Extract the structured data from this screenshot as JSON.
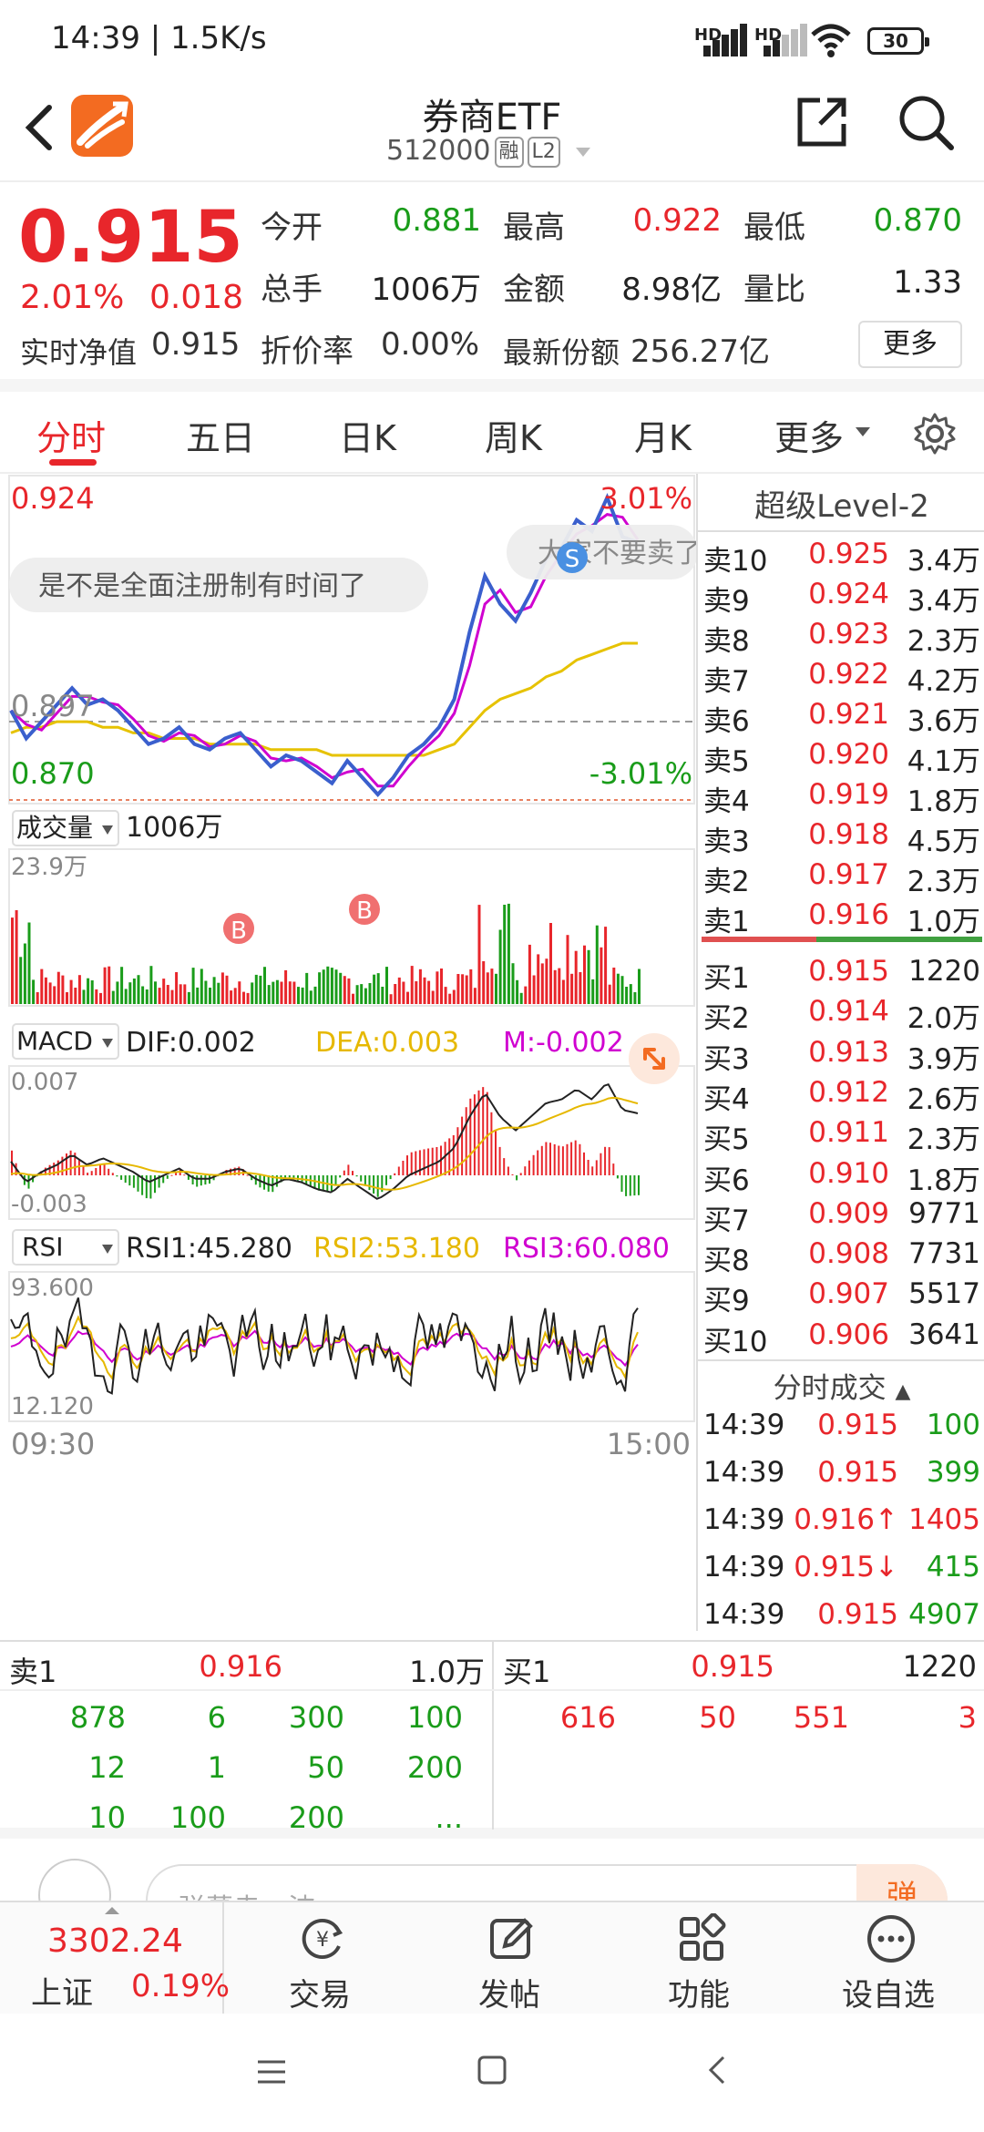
{
  "status": {
    "time": "14:39 | 1.5K/s",
    "sim1": "HD",
    "sim2": "HD",
    "battery": "30"
  },
  "header": {
    "title": "券商ETF",
    "code": "512000",
    "tag1": "融",
    "tag2": "L2"
  },
  "quote": {
    "price": "0.915",
    "change_pct": "2.01%",
    "change_abs": "0.018",
    "nav_label": "实时净值",
    "nav_value": "0.915",
    "open_label": "今开",
    "open_value": "0.881",
    "high_label": "最高",
    "high_value": "0.922",
    "low_label": "最低",
    "low_value": "0.870",
    "volume_label": "总手",
    "volume_value": "1006万",
    "amount_label": "金额",
    "amount_value": "8.98亿",
    "ratio_label": "量比",
    "ratio_value": "1.33",
    "discount_label": "折价率",
    "discount_value": "0.00%",
    "shares_label": "最新份额",
    "shares_value": "256.27亿",
    "more_label": "更多"
  },
  "tabs": [
    "分时",
    "五日",
    "日K",
    "周K",
    "月K",
    "更多"
  ],
  "chart": {
    "price_top": "0.924",
    "price_mid": "0.897",
    "price_bottom": "0.870",
    "pct_top": "3.01%",
    "pct_bottom": "-3.01%",
    "comment1": "是不是全面注册制有时间了",
    "comment2": "大家不要卖了",
    "marker_buy": "B",
    "marker_sell": "S",
    "vol_selector": "成交量",
    "vol_total": "1006万",
    "vol_max": "23.9万",
    "macd_selector": "MACD",
    "dif": "DIF:0.002",
    "dea": "DEA:0.003",
    "m": "M:-0.002",
    "macd_top": "0.007",
    "macd_bottom": "-0.003",
    "rsi_selector": "RSI",
    "rsi1": "RSI1:45.280",
    "rsi2": "RSI2:53.180",
    "rsi3": "RSI3:60.080",
    "rsi_top": "93.600",
    "rsi_bottom": "12.120",
    "time_start": "09:30",
    "time_end": "15:00",
    "colors": {
      "up": "#e8262b",
      "down": "#1a9c1a",
      "price_line": "#3a5fcd",
      "avg_line": "#e6c200",
      "ma_line": "#d000d0"
    }
  },
  "chart_data": {
    "type": "line",
    "title": "",
    "xlabel": "",
    "ylabel": "",
    "x_range": [
      "09:30",
      "15:00"
    ],
    "ylim": [
      0.87,
      0.924
    ],
    "series": [
      {
        "name": "",
        "values": [
          0.885,
          0.88,
          0.883,
          0.886,
          0.889,
          0.886,
          0.887,
          0.885,
          0.882,
          0.879,
          0.88,
          0.882,
          0.879,
          0.878,
          0.88,
          0.881,
          0.878,
          0.875,
          0.877,
          0.876,
          0.874,
          0.872,
          0.876,
          0.873,
          0.87,
          0.873,
          0.877,
          0.879,
          0.882,
          0.887,
          0.899,
          0.909,
          0.904,
          0.901,
          0.906,
          0.912,
          0.914,
          0.919,
          0.917,
          0.923,
          0.916,
          0.915
        ]
      },
      {
        "name": "",
        "values": [
          0.881,
          0.882,
          0.882,
          0.883,
          0.883,
          0.883,
          0.882,
          0.882,
          0.881,
          0.881,
          0.88,
          0.88,
          0.88,
          0.879,
          0.879,
          0.879,
          0.879,
          0.878,
          0.878,
          0.878,
          0.878,
          0.877,
          0.877,
          0.877,
          0.877,
          0.877,
          0.877,
          0.877,
          0.878,
          0.879,
          0.882,
          0.885,
          0.887,
          0.888,
          0.889,
          0.891,
          0.892,
          0.894,
          0.895,
          0.896,
          0.897,
          0.897
        ]
      }
    ]
  },
  "orderbook": {
    "title": "超级Level-2",
    "asks": [
      {
        "label": "卖10",
        "price": "0.925",
        "vol": "3.4万"
      },
      {
        "label": "卖9",
        "price": "0.924",
        "vol": "3.4万"
      },
      {
        "label": "卖8",
        "price": "0.923",
        "vol": "2.3万"
      },
      {
        "label": "卖7",
        "price": "0.922",
        "vol": "4.2万"
      },
      {
        "label": "卖6",
        "price": "0.921",
        "vol": "3.6万"
      },
      {
        "label": "卖5",
        "price": "0.920",
        "vol": "4.1万"
      },
      {
        "label": "卖4",
        "price": "0.919",
        "vol": "1.8万"
      },
      {
        "label": "卖3",
        "price": "0.918",
        "vol": "4.5万"
      },
      {
        "label": "卖2",
        "price": "0.917",
        "vol": "2.3万"
      },
      {
        "label": "卖1",
        "price": "0.916",
        "vol": "1.0万"
      }
    ],
    "bids": [
      {
        "label": "买1",
        "price": "0.915",
        "vol": "1220"
      },
      {
        "label": "买2",
        "price": "0.914",
        "vol": "2.0万"
      },
      {
        "label": "买3",
        "price": "0.913",
        "vol": "3.9万"
      },
      {
        "label": "买4",
        "price": "0.912",
        "vol": "2.6万"
      },
      {
        "label": "买5",
        "price": "0.911",
        "vol": "2.3万"
      },
      {
        "label": "买6",
        "price": "0.910",
        "vol": "1.8万"
      },
      {
        "label": "买7",
        "price": "0.909",
        "vol": "9771"
      },
      {
        "label": "买8",
        "price": "0.908",
        "vol": "7731"
      },
      {
        "label": "买9",
        "price": "0.907",
        "vol": "5517"
      },
      {
        "label": "买10",
        "price": "0.906",
        "vol": "3641"
      }
    ],
    "trades_title": "分时成交",
    "trades": [
      {
        "time": "14:39",
        "price": "0.915",
        "vol": "100",
        "vol_color": "green",
        "arrow": ""
      },
      {
        "time": "14:39",
        "price": "0.915",
        "vol": "399",
        "vol_color": "green",
        "arrow": ""
      },
      {
        "time": "14:39",
        "price": "0.916↑",
        "vol": "1405",
        "vol_color": "red",
        "arrow": "up"
      },
      {
        "time": "14:39",
        "price": "0.915↓",
        "vol": "415",
        "vol_color": "green",
        "arrow": "down"
      },
      {
        "time": "14:39",
        "price": "0.915",
        "vol": "4907",
        "vol_color": "green",
        "arrow": ""
      }
    ]
  },
  "queue": {
    "ask_label": "卖1",
    "ask_price": "0.916",
    "ask_vol": "1.0万",
    "bid_label": "买1",
    "bid_price": "0.915",
    "bid_vol": "1220",
    "ask_orders": [
      [
        "878",
        "6",
        "300",
        "100"
      ],
      [
        "12",
        "1",
        "50",
        "200"
      ],
      [
        "10",
        "100",
        "200",
        "..."
      ]
    ],
    "bid_orders": [
      "616",
      "50",
      "551",
      "3"
    ]
  },
  "comment_bar": {
    "placeholder": "弹幕走一波",
    "send_label": "弹"
  },
  "bottom_nav": {
    "index_value": "3302.24",
    "index_name": "上证",
    "index_pct": "0.19%",
    "items": [
      {
        "label": "交易",
        "icon": "trade-icon"
      },
      {
        "label": "发帖",
        "icon": "post-icon"
      },
      {
        "label": "功能",
        "icon": "function-icon"
      },
      {
        "label": "设自选",
        "icon": "watchlist-icon"
      }
    ]
  }
}
